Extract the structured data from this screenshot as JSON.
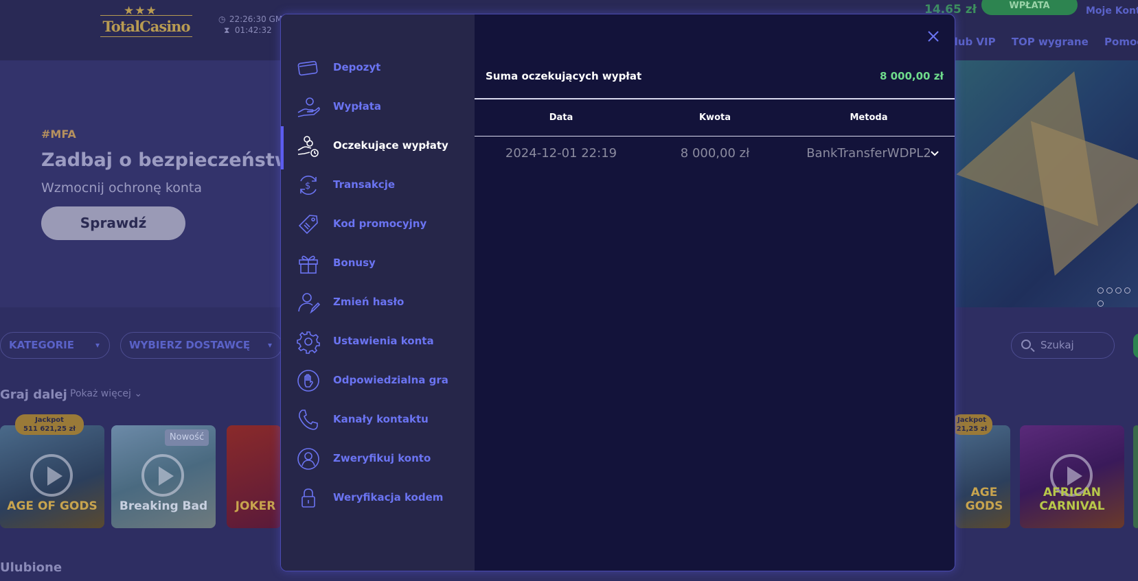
{
  "site": {
    "logo_text": "TotalCasino",
    "logo_stars": "★★★",
    "clock_time": "22:26:30 GM",
    "session_time": "01:42:32",
    "balance": "14.65 zł",
    "deposit_button": "WPŁATA",
    "account_link": "Moje Konto",
    "nav_links": [
      "Klub VIP",
      "TOP wygrane",
      "Pomoc"
    ],
    "hero": {
      "tag": "#MFA",
      "title": "Zadbaj o bezpieczeństwo",
      "subtitle": "Wzmocnij ochronę konta",
      "cta": "Sprawdź"
    },
    "filters": {
      "categories": "KATEGORIE",
      "provider": "WYBIERZ DOSTAWCĘ",
      "search_placeholder": "Szukaj"
    },
    "continue_section": {
      "title": "Graj dalej",
      "more": "Pokaż więcej"
    },
    "favorites_title": "Ulubione",
    "games": [
      {
        "name": "AGE OF GODS",
        "badge": "Jackpot",
        "jackpot": "511 621,25 zł"
      },
      {
        "name": "Breaking Bad",
        "badge": "Nowość"
      },
      {
        "name": "JOKER"
      },
      {
        "name": "AGE GODS",
        "badge": "Jackpot",
        "jackpot": "21,25 zł"
      },
      {
        "name": "AFRICAN CARNIVAL"
      }
    ]
  },
  "modal": {
    "menu": [
      {
        "label": "Depozyt",
        "icon": "card-icon"
      },
      {
        "label": "Wypłata",
        "icon": "hand-coin-icon"
      },
      {
        "label": "Oczekujące wypłaty",
        "icon": "pending-coins-icon",
        "active": true
      },
      {
        "label": "Transakcje",
        "icon": "dollar-cycle-icon"
      },
      {
        "label": "Kod promocyjny",
        "icon": "tag-icon"
      },
      {
        "label": "Bonusy",
        "icon": "gift-icon"
      },
      {
        "label": "Zmień hasło",
        "icon": "user-edit-icon"
      },
      {
        "label": "Ustawienia konta",
        "icon": "gear-icon"
      },
      {
        "label": "Odpowiedzialna gra",
        "icon": "hand-stop-icon"
      },
      {
        "label": "Kanały kontaktu",
        "icon": "phone-icon"
      },
      {
        "label": "Zweryfikuj konto",
        "icon": "user-circle-icon"
      },
      {
        "label": "Weryfikacja kodem",
        "icon": "lock-icon"
      }
    ],
    "summary": {
      "label": "Suma oczekujących wypłat",
      "value": "8 000,00 zł"
    },
    "table": {
      "headers": [
        "Data",
        "Kwota",
        "Metoda"
      ],
      "rows": [
        [
          "2024-12-01 22:19",
          "8 000,00 zł",
          "BankTransferWDPL2"
        ]
      ]
    },
    "colors": {
      "accent": "#6b74f2",
      "active_text": "#ffffff",
      "amount_green": "#6fdc8c"
    }
  }
}
